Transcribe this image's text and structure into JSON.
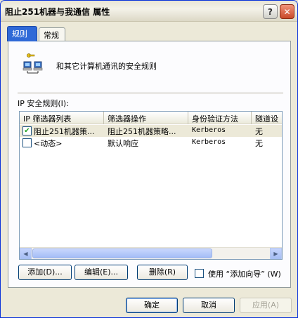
{
  "window": {
    "title": "阻止251机器与我通信 属性",
    "help_glyph": "?",
    "close_glyph": "✕"
  },
  "tabs": [
    {
      "label": "规则",
      "active": true
    },
    {
      "label": "常规",
      "active": false
    }
  ],
  "panel": {
    "description": "和其它计算机通讯的安全规则",
    "list_label": "IP 安全规则(I):"
  },
  "list": {
    "columns": [
      "IP 筛选器列表",
      "筛选器操作",
      "身份验证方法",
      "隧道设"
    ],
    "rows": [
      {
        "checked": true,
        "check_glyph": "✔",
        "filter_list": "阻止251机器策...",
        "filter_action": "阻止251机器策略...",
        "auth": "Kerberos",
        "tunnel": "无"
      },
      {
        "checked": false,
        "check_glyph": "",
        "filter_list": "<动态>",
        "filter_action": "默认响应",
        "auth": "Kerberos",
        "tunnel": "无"
      }
    ],
    "scroll_left_glyph": "◀",
    "scroll_right_glyph": "▶"
  },
  "actions": {
    "add": "添加(D)...",
    "edit": "编辑(E)...",
    "remove": "删除(R)",
    "use_wizard": "使用 “添加向导” (W)"
  },
  "footer": {
    "ok": "确定",
    "cancel": "取消",
    "apply": "应用(A)"
  },
  "colors": {
    "active_tab": "#2f69d7",
    "check": "#21a121",
    "window_border": "#0831d9"
  },
  "icons": {
    "rule_icon": "network-computers-key-icon",
    "help": "help-icon",
    "close": "close-icon"
  }
}
